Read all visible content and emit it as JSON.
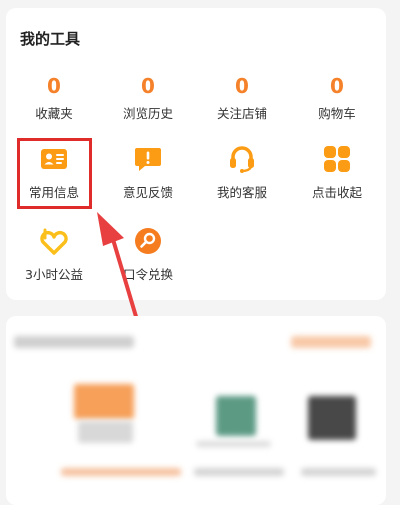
{
  "tools": {
    "title": "我的工具",
    "stats": [
      {
        "value": "0",
        "label": "收藏夹"
      },
      {
        "value": "0",
        "label": "浏览历史"
      },
      {
        "value": "0",
        "label": "关注店铺"
      },
      {
        "value": "0",
        "label": "购物车"
      }
    ],
    "row1": [
      {
        "icon": "id-card-icon",
        "label": "常用信息"
      },
      {
        "icon": "feedback-icon",
        "label": "意见反馈"
      },
      {
        "icon": "headset-icon",
        "label": "我的客服"
      },
      {
        "icon": "grid-collapse-icon",
        "label": "点击收起"
      }
    ],
    "row2": [
      {
        "icon": "charity-heart-icon",
        "label": "3小时公益"
      },
      {
        "icon": "code-redeem-icon",
        "label": "口令兑换"
      }
    ]
  },
  "colors": {
    "accent": "#f5822a",
    "icon_orange": "#fb9c14",
    "highlight": "#e02b2b"
  }
}
